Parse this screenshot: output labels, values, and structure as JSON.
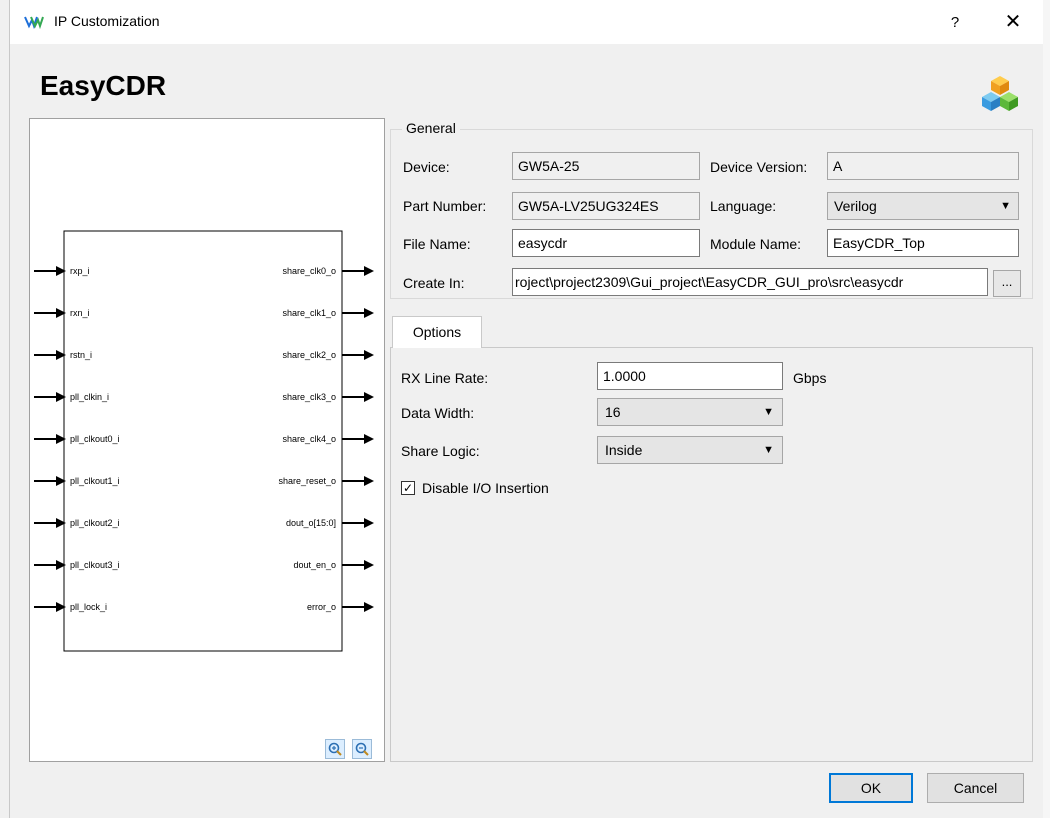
{
  "window": {
    "title": "IP Customization",
    "help_label": "?",
    "close_label": "✕"
  },
  "header": {
    "ip_name": "EasyCDR"
  },
  "symbol": {
    "inputs": [
      "rxp_i",
      "rxn_i",
      "rstn_i",
      "pll_clkin_i",
      "pll_clkout0_i",
      "pll_clkout1_i",
      "pll_clkout2_i",
      "pll_clkout3_i",
      "pll_lock_i"
    ],
    "outputs": [
      "share_clk0_o",
      "share_clk1_o",
      "share_clk2_o",
      "share_clk3_o",
      "share_clk4_o",
      "share_reset_o",
      "dout_o[15:0]",
      "dout_en_o",
      "error_o"
    ]
  },
  "general": {
    "legend": "General",
    "device_label": "Device:",
    "device_value": "GW5A-25",
    "device_version_label": "Device Version:",
    "device_version_value": "A",
    "part_number_label": "Part Number:",
    "part_number_value": "GW5A-LV25UG324ES",
    "language_label": "Language:",
    "language_value": "Verilog",
    "file_name_label": "File Name:",
    "file_name_value": "easycdr",
    "module_name_label": "Module Name:",
    "module_name_value": "EasyCDR_Top",
    "create_in_label": "Create In:",
    "create_in_value": "roject\\project2309\\Gui_project\\EasyCDR_GUI_pro\\src\\easycdr",
    "browse_label": "..."
  },
  "options": {
    "tab_label": "Options",
    "rx_line_rate_label": "RX Line Rate:",
    "rx_line_rate_value": "1.0000",
    "rx_line_rate_unit": "Gbps",
    "data_width_label": "Data Width:",
    "data_width_value": "16",
    "share_logic_label": "Share Logic:",
    "share_logic_value": "Inside",
    "disable_io_label": "Disable I/O Insertion",
    "disable_io_checked": true,
    "check_mark": "✓"
  },
  "footer": {
    "ok_label": "OK",
    "cancel_label": "Cancel"
  },
  "colors": {
    "focus_border": "#0078d7",
    "panel_bg": "#f0f0f0",
    "field_border": "#7a7a7a"
  }
}
